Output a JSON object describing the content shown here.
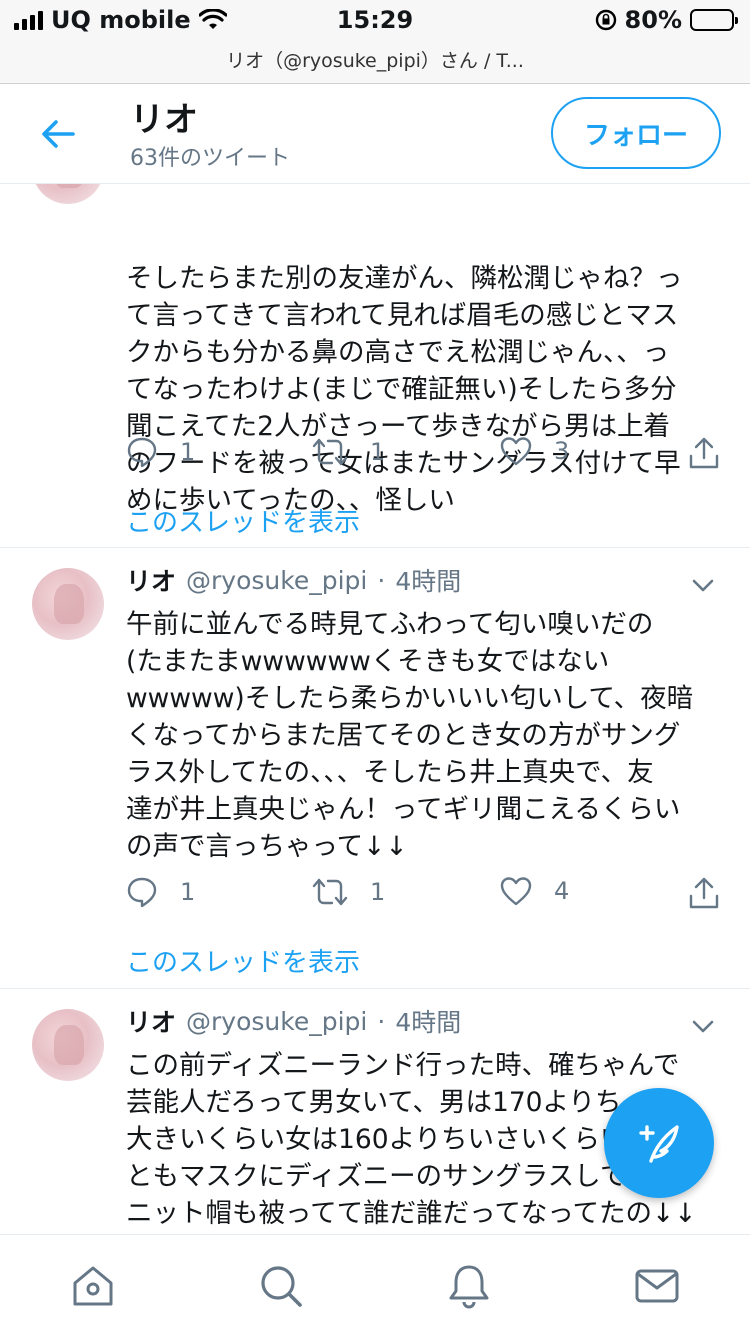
{
  "status_bar": {
    "carrier": "UQ mobile",
    "time": "15:29",
    "battery": "80%",
    "battery_level": 0.8
  },
  "url_bar": {
    "title": "リオ（@ryosuke_pipi）さん / T..."
  },
  "header": {
    "title": "リオ",
    "subtitle": "63件のツイート",
    "follow_label": "フォロー",
    "accent_color": "#1da1f2"
  },
  "tweets": [
    {
      "lines": [
        "そしたらまた別の友達がん、隣松潤じゃね？っ",
        "て言ってきて言われて見れば眉毛の感じとマス",
        "クからも分かる鼻の高さでえ松潤じゃん、、っ",
        "てなったわけよ(まじで確証無い)そしたら多分",
        "聞こえてた2人がさっーて歩きながら男は上着",
        "のフードを被って女はまたサングラス付けて早",
        "めに歩いてったの、、怪しい"
      ],
      "replies": "1",
      "retweets": "1",
      "likes": "3",
      "thread_link": "このスレッドを表示"
    },
    {
      "name": "リオ",
      "handle": "@ryosuke_pipi",
      "dot": "·",
      "time": "4時間",
      "lines": [
        "午前に並んでる時見てふわって匂い嗅いだの",
        "(たまたまwwwwwwくそきも女ではない",
        "wwwww)そしたら柔らかいいい匂いして、夜暗",
        "くなってからまた居てそのとき女の方がサング",
        "ラス外してたの、、、そしたら井上真央で、友",
        "達が井上真央じゃん！ってギリ聞こえるくらい",
        "の声で言っちゃって↓↓"
      ],
      "replies": "1",
      "retweets": "1",
      "likes": "4",
      "thread_link": "このスレッドを表示"
    },
    {
      "name": "リオ",
      "handle": "@ryosuke_pipi",
      "dot": "·",
      "time": "4時間",
      "lines": [
        "この前ディズニーランド行った時、確ちゃんで",
        "芸能人だろって男女いて、男は170よりちょい",
        "大きいくらい女は160よりちいさいくらい、2人",
        "ともマスクにディズニーのサングラスして男は",
        "ニット帽も被ってて誰だ誰だってなってたの↓↓"
      ]
    }
  ],
  "icons": {
    "back": "arrow-left-icon",
    "compose": "compose-feather-icon",
    "tabs": [
      "home-icon",
      "search-icon",
      "bell-icon",
      "mail-icon"
    ]
  }
}
